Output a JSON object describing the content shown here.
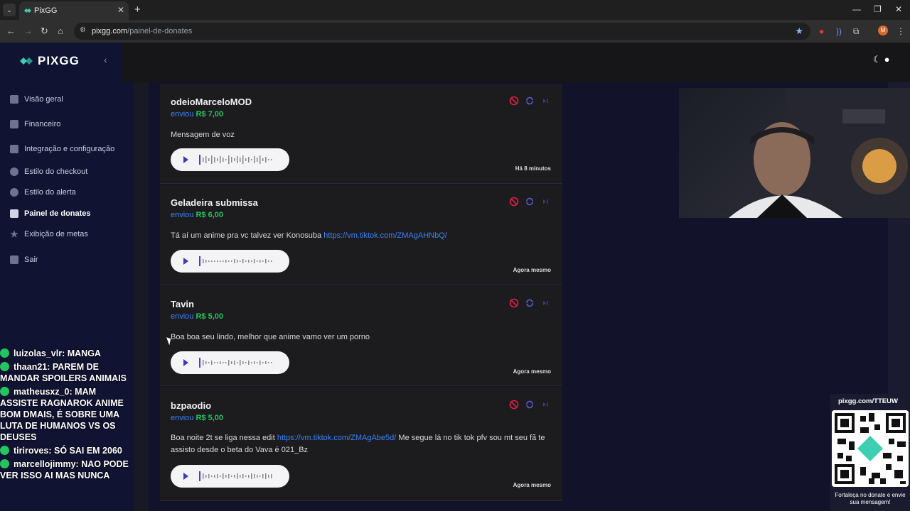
{
  "browser": {
    "tab_title": "PixGG",
    "url_host": "pixgg.com",
    "url_path": "/painel-de-donates"
  },
  "sidebar": {
    "brand": "PIXGG",
    "items": [
      {
        "label": "Visão geral",
        "icon": "home-icon"
      },
      {
        "label": "Financeiro",
        "icon": "wallet-icon"
      },
      {
        "label": "Integração e configuração",
        "icon": "settings-icon"
      },
      {
        "label": "Estilo do checkout",
        "icon": "palette-icon"
      },
      {
        "label": "Estilo do alerta",
        "icon": "palette-icon"
      },
      {
        "label": "Painel de donates",
        "icon": "donate-icon"
      },
      {
        "label": "Exibição de metas",
        "icon": "star-icon"
      },
      {
        "label": "Sair",
        "icon": "logout-icon"
      }
    ],
    "active_index": 5
  },
  "donates": [
    {
      "name": "odeioMarceloMOD",
      "sent": "enviou",
      "amount": "R$ 7,00",
      "message": "Mensagem de voz",
      "link": "",
      "message_after": "",
      "time": "Há 8 minutos"
    },
    {
      "name": "Geladeira submissa",
      "sent": "enviou",
      "amount": "R$ 6,00",
      "message": "Tá aí um anime pra vc talvez ver Konosuba ",
      "link": "https://vm.tiktok.com/ZMAgAHNbQ/",
      "message_after": "",
      "time": "Agora mesmo"
    },
    {
      "name": "Tavin",
      "sent": "enviou",
      "amount": "R$ 5,00",
      "message": "Boa boa seu lindo, melhor que anime vamo ver um porno",
      "link": "",
      "message_after": "",
      "time": "Agora mesmo"
    },
    {
      "name": "bzpaodio",
      "sent": "enviou",
      "amount": "R$ 5,00",
      "message": "Boa noite 2t se liga nessa edit ",
      "link": "https://vm.tiktok.com/ZMAgAbe5d/",
      "message_after": " Me segue lá no tik tok pfv sou mt seu fã te assisto desde o beta do Vava é 021_Bz",
      "time": "Agora mesmo"
    }
  ],
  "chat": [
    {
      "user": "luizolas_vlr:",
      "text": "MANGA"
    },
    {
      "user": "thaan21:",
      "text": "PAREM DE MANDAR SPOILERS ANIMAIS"
    },
    {
      "user": "matheusxz_0:",
      "text": "MAM ASSISTE RAGNAROK ANIME BOM DMAIS, É SOBRE UMA LUTA DE HUMANOS VS OS DEUSES"
    },
    {
      "user": "tiriroves:",
      "text": "SÓ SAI EM 2060"
    },
    {
      "user": "marcellojimmy:",
      "text": "NAO PODE VER ISSO AI MAS NUNCA"
    }
  ],
  "qr": {
    "url": "pixgg.com/TTEUW",
    "caption": "Fortaleça no donate e envie sua mensagem!"
  },
  "colors": {
    "accent": "#3b82f6",
    "amount": "#22c55e",
    "sidebar_bg": "#101331"
  }
}
